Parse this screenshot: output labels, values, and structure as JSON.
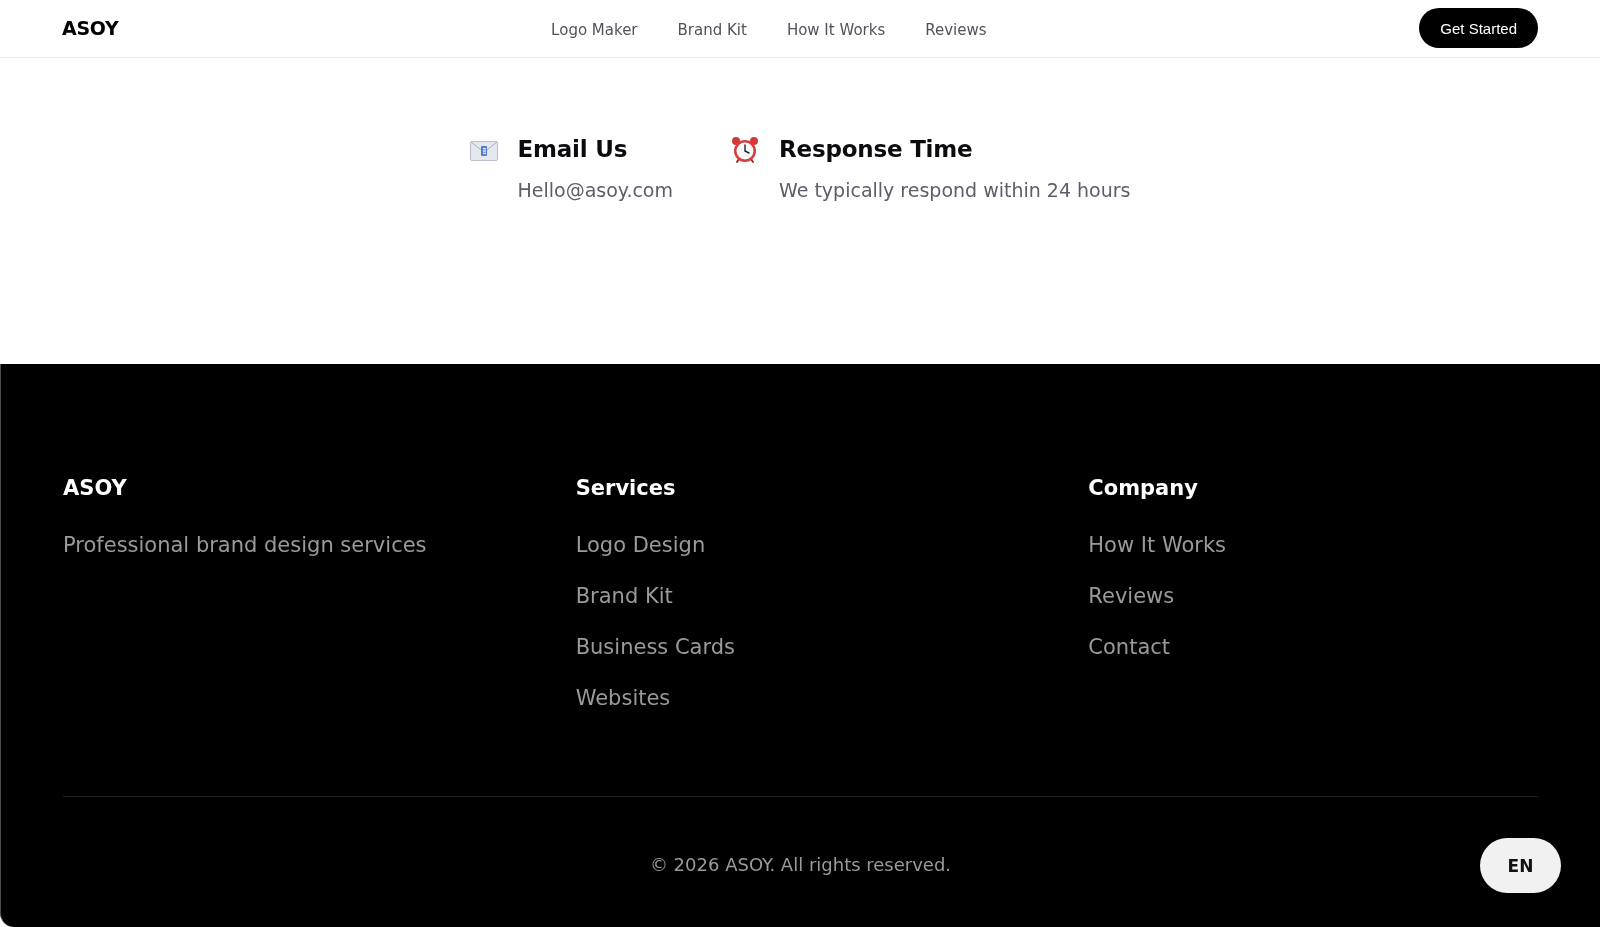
{
  "header": {
    "logo": "ASOY",
    "nav": [
      {
        "label": "Logo Maker"
      },
      {
        "label": "Brand Kit"
      },
      {
        "label": "How It Works"
      },
      {
        "label": "Reviews"
      }
    ],
    "cta": "Get Started"
  },
  "contact": [
    {
      "kind": "email",
      "title": "Email Us",
      "text": "Hello@asoy.com"
    },
    {
      "kind": "clock",
      "title": "Response Time",
      "text": "We typically respond within 24 hours"
    }
  ],
  "footer": {
    "brand": {
      "title": "ASOY",
      "tagline": "Professional brand design services"
    },
    "columns": [
      {
        "title": "Services",
        "links": [
          "Logo Design",
          "Brand Kit",
          "Business Cards",
          "Websites"
        ]
      },
      {
        "title": "Company",
        "links": [
          "How It Works",
          "Reviews",
          "Contact"
        ]
      }
    ],
    "copyright": "© 2026 ASOY. All rights reserved.",
    "language": "EN"
  }
}
